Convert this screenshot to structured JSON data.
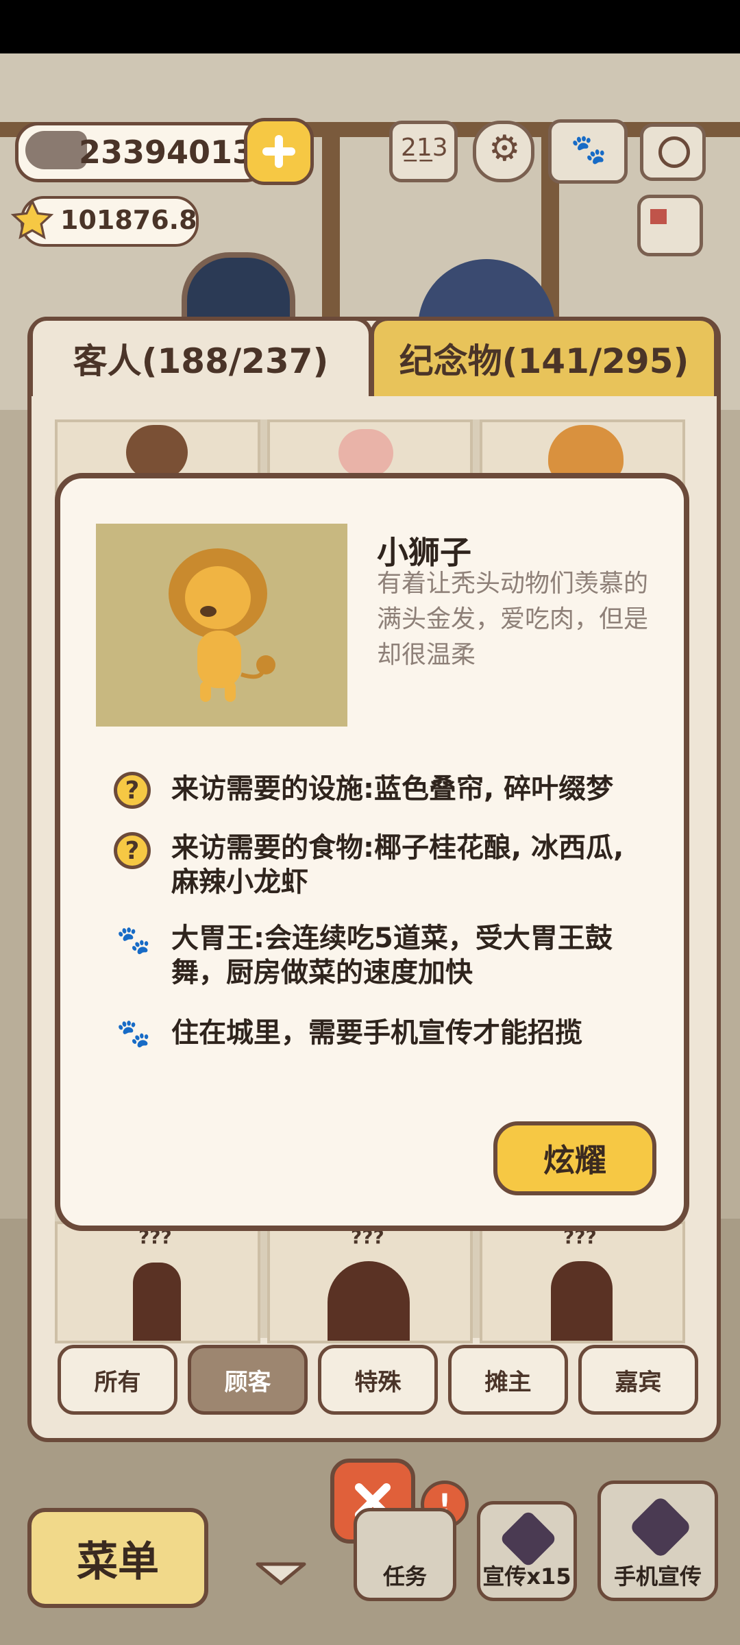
{
  "currency": {
    "fish": "23394013",
    "stars": "101876.8"
  },
  "tabs": {
    "guests": "客人(188/237)",
    "souvenirs": "纪念物(141/295)"
  },
  "detail": {
    "name": "小狮子",
    "description": "有着让秃头动物们羡慕的满头金发，爱吃肉，但是却很温柔",
    "requirements": [
      {
        "icon": "question-icon",
        "text": "来访需要的设施:蓝色叠帘, 碎叶缀梦"
      },
      {
        "icon": "question-icon",
        "text": "来访需要的食物:椰子桂花酿, 冰西瓜, 麻辣小龙虾"
      },
      {
        "icon": "paw-icon",
        "text": "大胃王:会连续吃5道菜，受大胃王鼓舞，厨房做菜的速度加快"
      },
      {
        "icon": "paw-icon",
        "text": "住在城里，需要手机宣传才能招揽"
      }
    ],
    "show_button": "炫耀"
  },
  "unknown_mark": "???",
  "filters": [
    {
      "label": "所有",
      "active": false
    },
    {
      "label": "顾客",
      "active": true
    },
    {
      "label": "特殊",
      "active": false
    },
    {
      "label": "摊主",
      "active": false
    },
    {
      "label": "嘉宾",
      "active": false
    }
  ],
  "bottom": {
    "menu": "菜单",
    "tasks": "任务",
    "promo": "宣传x15",
    "phone_promo": "手机宣传"
  },
  "colors": {
    "accent": "#f6c844",
    "border": "#6b4a3a",
    "panel": "#fbf5ec"
  }
}
